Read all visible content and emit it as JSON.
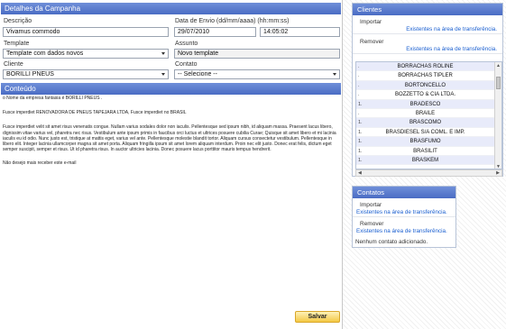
{
  "campaign": {
    "header": "Detalhes da Campanha",
    "description_label": "Descrição",
    "description_value": "Vivamus commodo",
    "send_date_label": "Data de Envio (dd/mm/aaaa) (hh:mm:ss)",
    "send_date_value": "29/07/2010",
    "send_time_value": "14:05:02",
    "template_label": "Template",
    "template_value": "Template com dados novos",
    "subject_label": "Assunto",
    "subject_value": "Novo template",
    "client_label": "Cliente",
    "client_value": "BORILLI PNEUS",
    "contact_label": "Contato",
    "contact_value": "-- Selecione --"
  },
  "content": {
    "header": "Conteúdo",
    "line1": "o Nome da empresa fantasia é BORILLI PNEUS .",
    "line2": "Fusce imperdiet  RENOVADORA DE PNEUS TAPEJARA LTDA,  Fusce imperdiet no BRASIL",
    "paragraph": "Fusce imperdiet velit sit amet risus venenatis congue. Nullam varius sodales dolor non iaculis. Pellentesque sed ipsum nibh, id aliquam massa. Praesent lacus libero, dignissim vitae varius vel, pharetra nec risus. Vestibulum ante ipsum primis in faucibus orci luctus et ultrices posuere cubilia Curae; Quisque sit amet libero et mi lacinia iaculis eu id odio. Nunc justo est, tristique at mattis eget, varius vel ante. Pellentesque molestie blandit tortor. Aliquam cursus consectetur vestibulum. Pellentesque in libero elit. Integer lacinia ullamcorper magna sit amet porta. Aliquam fringilla ipsum sit amet lorem aliquam interdum. Proin nec elit justo. Donec erat felis, dictum eget semper suscipit, semper et risus. Ut id pharetra risus. In auctor ultricies lacinia. Donec posuere lacus porttitor mauris tempus hendrerit.",
    "footer": "Não desejo mais receber este e-mail",
    "save_label": "Salvar"
  },
  "clients": {
    "header": "Clientes",
    "import_label": "Importar",
    "import_link": "Existentes na área de transferência.",
    "remove_label": "Remover",
    "remove_link": "Existentes na área de transferência.",
    "rows": [
      {
        "idx": ".",
        "name": "BORRACHAS ROLINE"
      },
      {
        "idx": ".",
        "name": "BORRACHAS TIPLER"
      },
      {
        "idx": ".",
        "name": "BORTONCELLO"
      },
      {
        "idx": ".",
        "name": "BOZZETTO & CIA LTDA."
      },
      {
        "idx": "1.",
        "name": "BRADESCO"
      },
      {
        "idx": ".",
        "name": "BRAILE"
      },
      {
        "idx": "1.",
        "name": "BRASCOMO"
      },
      {
        "idx": "1.",
        "name": "BRASDIESEL S/A COML. E IMP."
      },
      {
        "idx": "1.",
        "name": "BRASFUMO"
      },
      {
        "idx": "1.",
        "name": "BRASILIT"
      },
      {
        "idx": "1.",
        "name": "BRASKEM"
      }
    ]
  },
  "contacts": {
    "header": "Contatos",
    "import_label": "Importar",
    "import_link": "Existentes na área de transferência.",
    "remove_label": "Remover",
    "remove_link": "Existentes na área de transferência.",
    "empty_message": "Nenhum contato adicionado."
  }
}
